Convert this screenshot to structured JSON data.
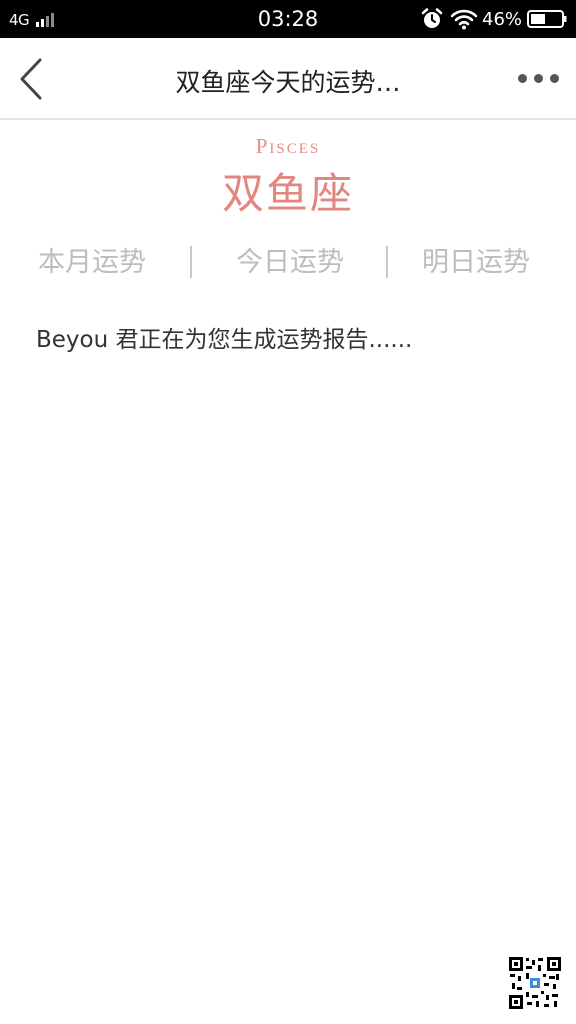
{
  "status_bar": {
    "network": "4G",
    "time": "03:28",
    "battery_percent": "46%",
    "icons": [
      "signal-icon",
      "alarm-icon",
      "wifi-icon",
      "battery-icon"
    ]
  },
  "nav": {
    "title": "双鱼座今天的运势…",
    "back_icon": "back-chevron-icon",
    "more_icon": "more-dots-icon"
  },
  "sign": {
    "english": "Pisces",
    "chinese": "双鱼座",
    "accent_color": "#e2877f"
  },
  "tabs": [
    {
      "label": "本月运势"
    },
    {
      "label": "今日运势"
    },
    {
      "label": "明日运势"
    }
  ],
  "message": "Beyou 君正在为您生成运势报告......",
  "footer": {
    "qr_icon": "qr-code-icon"
  }
}
